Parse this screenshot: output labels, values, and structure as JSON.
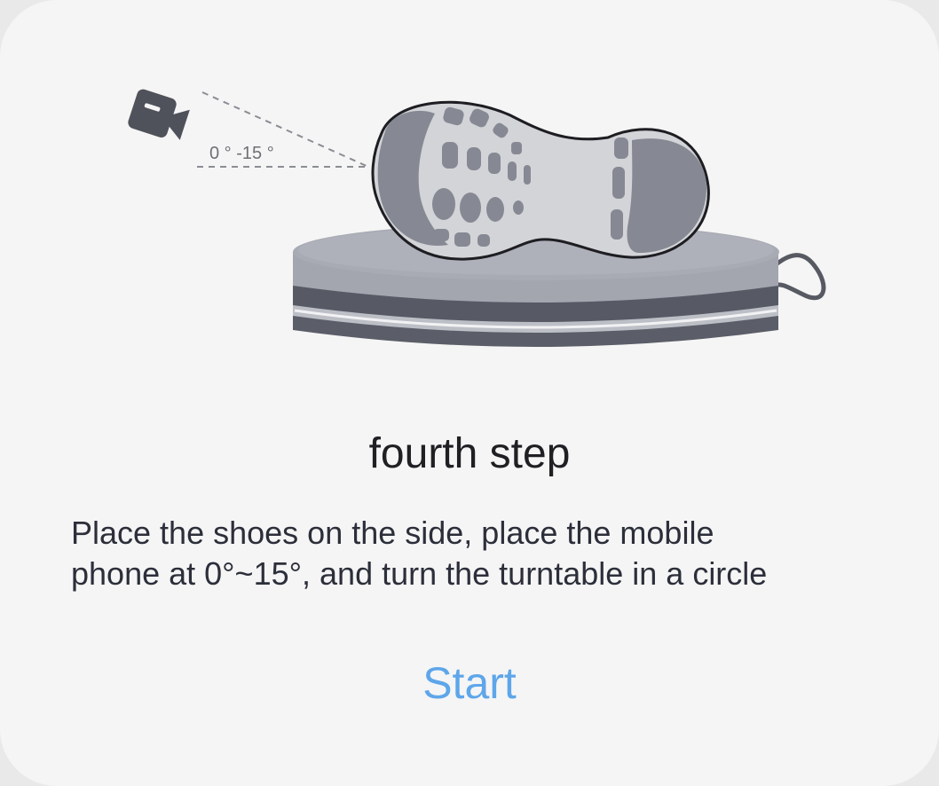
{
  "illustration": {
    "angle_label": "0 ° -15 °",
    "icons": [
      "camera-icon",
      "shoe-sole",
      "turntable"
    ],
    "colors": {
      "camera": "#4f525b",
      "sole_dark": "#878a94",
      "sole_light": "#d2d3d7",
      "turntable_top": "#a7a9b3",
      "turntable_band": "#585b65",
      "turntable_light": "#b9bbc3"
    }
  },
  "step": {
    "title": "fourth step",
    "description_line1": "Place the shoes on the side, place the mobile",
    "description_line2": "phone at 0°~15°, and turn the turntable in a circle"
  },
  "actions": {
    "start_label": "Start",
    "start_color": "#5ea6ea"
  }
}
